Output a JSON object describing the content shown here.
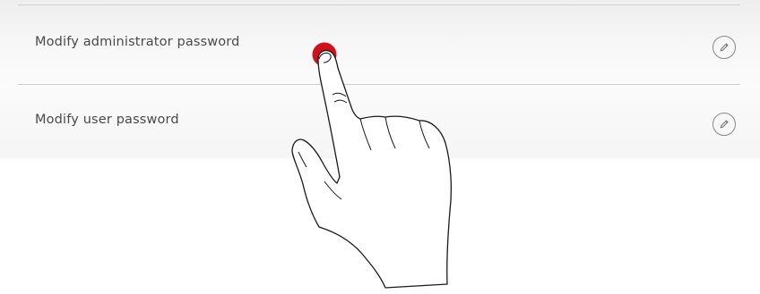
{
  "settings": {
    "rows": [
      {
        "label": "Modify administrator password",
        "action_icon": "pencil-icon"
      },
      {
        "label": "Modify user password",
        "action_icon": "pencil-icon"
      }
    ]
  },
  "gesture": {
    "type": "tap",
    "icon": "hand-pointer-icon",
    "target_row": "Modify administrator password",
    "touch_color": "#d0101b"
  }
}
